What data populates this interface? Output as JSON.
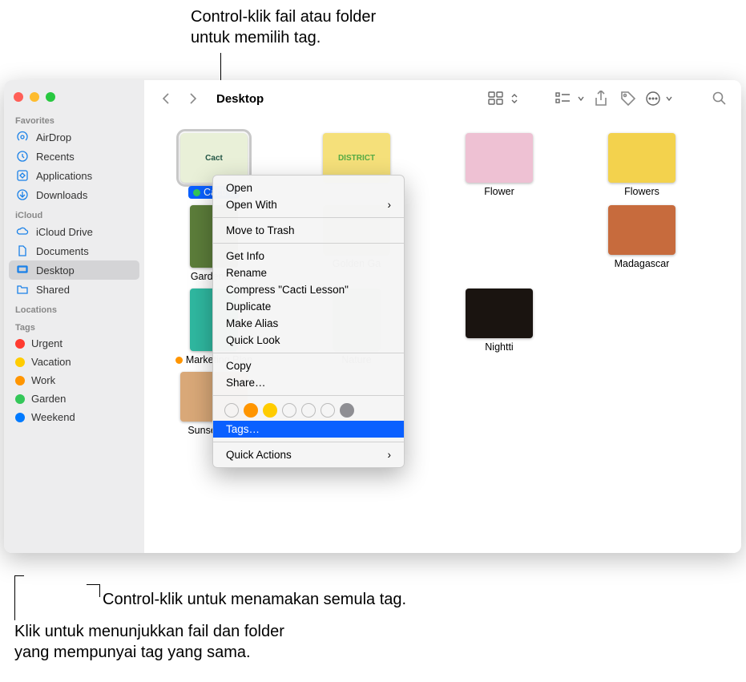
{
  "callouts": {
    "top": "Control-klik fail atau folder\nuntuk memilih tag.",
    "mid": "Control-klik untuk menamakan semula tag.",
    "bot": "Klik untuk menunjukkan fail dan folder\nyang mempunyai tag yang sama."
  },
  "sidebar": {
    "sections": {
      "favorites": "Favorites",
      "icloud": "iCloud",
      "locations": "Locations",
      "tags": "Tags"
    },
    "favorites": [
      {
        "icon": "airdrop",
        "label": "AirDrop"
      },
      {
        "icon": "recents",
        "label": "Recents"
      },
      {
        "icon": "apps",
        "label": "Applications"
      },
      {
        "icon": "downloads",
        "label": "Downloads"
      }
    ],
    "icloud": [
      {
        "icon": "cloud",
        "label": "iCloud Drive"
      },
      {
        "icon": "doc",
        "label": "Documents"
      },
      {
        "icon": "desktop",
        "label": "Desktop",
        "selected": true
      },
      {
        "icon": "shared",
        "label": "Shared"
      }
    ],
    "tags": [
      {
        "color": "#ff3b30",
        "label": "Urgent"
      },
      {
        "color": "#ffcc00",
        "label": "Vacation"
      },
      {
        "color": "#ff9500",
        "label": "Work"
      },
      {
        "color": "#34c759",
        "label": "Garden"
      },
      {
        "color": "#007aff",
        "label": "Weekend"
      }
    ]
  },
  "toolbar": {
    "title": "Desktop"
  },
  "files": [
    {
      "label": "Cacti L",
      "thumb": "Cact",
      "selected": true,
      "dot": "#34c759",
      "bg": "#e9f0d8",
      "fg": "#254"
    },
    {
      "label": "",
      "thumb": "DISTRICT",
      "bg": "#f5e07a",
      "fg": "#5a4"
    },
    {
      "label": "Flower",
      "thumb": "",
      "bg": "#eec1d3"
    },
    {
      "label": "Flowers",
      "thumb": "",
      "bg": "#f3d24d"
    },
    {
      "label": "Gardening",
      "thumb": "",
      "bg": "#5c7d3a",
      "tall": true
    },
    {
      "label": "Golden Ga",
      "thumb": "",
      "bg": "#c7b08a"
    },
    {
      "label": "",
      "thumb": "",
      "hidden": true
    },
    {
      "label": "Madagascar",
      "thumb": "",
      "bg": "#c76b3d"
    },
    {
      "label": "Marketing Plan",
      "thumb": "",
      "bg": "#2fb8a0",
      "tall": true,
      "dot": "#ff9500"
    },
    {
      "label": "Nature",
      "thumb": "",
      "bg": "#a8c28f",
      "tall": true
    },
    {
      "label": "Nightti",
      "thumb": "",
      "bg": "#1a1410"
    },
    {
      "label": "",
      "thumb": "",
      "hidden": true
    },
    {
      "label": "Sunset Surf",
      "thumb": "",
      "bg": "#d9a878"
    }
  ],
  "context_menu": {
    "items1": [
      "Open",
      "Open With"
    ],
    "items2": [
      "Move to Trash"
    ],
    "items3": [
      "Get Info",
      "Rename",
      "Compress \"Cacti Lesson\"",
      "Duplicate",
      "Make Alias",
      "Quick Look"
    ],
    "items4": [
      "Copy",
      "Share…"
    ],
    "tags_label": "Tags…",
    "items5": [
      "Quick Actions"
    ],
    "tag_colors": [
      "transparent",
      "#ff9500",
      "#ffcc00",
      "transparent",
      "transparent",
      "transparent",
      "#8e8e93"
    ]
  }
}
